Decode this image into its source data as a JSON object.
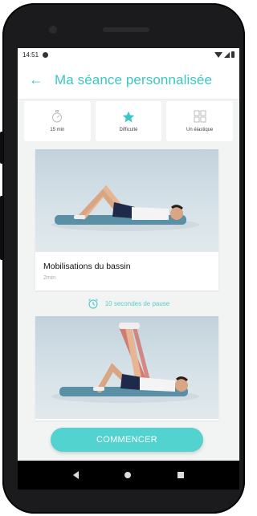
{
  "status_bar": {
    "time": "14:51"
  },
  "header": {
    "title": "Ma séance personnalisée",
    "back_icon": "arrow-left-icon"
  },
  "info_cards": [
    {
      "icon": "stopwatch-icon",
      "label": "15 min"
    },
    {
      "icon": "star-icon",
      "label": "Difficulté"
    },
    {
      "icon": "grid-icon",
      "label": "Un élastique"
    }
  ],
  "exercises": [
    {
      "name": "Mobilisations du bassin",
      "duration": "2min"
    },
    {
      "name": "",
      "duration": ""
    }
  ],
  "pause": {
    "icon": "alarm-icon",
    "text": "10 secondes de pause"
  },
  "start_button": {
    "label": "COMMENCER"
  },
  "colors": {
    "accent": "#3cc7c4",
    "button": "#52d3d0",
    "mat": "#5a8fa6"
  }
}
